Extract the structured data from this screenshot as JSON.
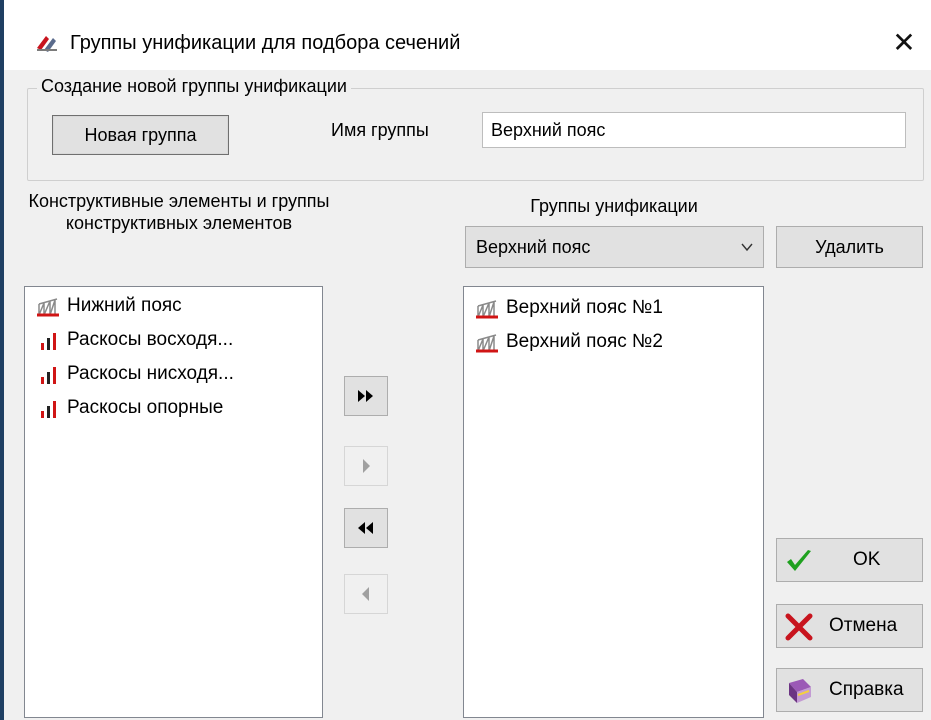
{
  "window": {
    "title": "Группы унификации для подбора сечений",
    "close_glyph": "✕"
  },
  "new_group": {
    "groupbox_title": "Создание новой группы унификации",
    "new_group_button": "Новая группа",
    "name_label": "Имя группы",
    "name_value": "Верхний пояс"
  },
  "left_panel": {
    "heading": "Конструктивные элементы и группы конструктивных элементов",
    "items": [
      {
        "label": "Нижний пояс",
        "icon": "truss-chord-icon"
      },
      {
        "label": "Раскосы восходя...",
        "icon": "bar-chart-icon"
      },
      {
        "label": "Раскосы нисходя...",
        "icon": "bar-chart-icon"
      },
      {
        "label": "Раскосы опорные",
        "icon": "bar-chart-icon"
      }
    ]
  },
  "right_panel": {
    "heading": "Группы унификации",
    "selected_group": "Верхний пояс",
    "delete_button": "Удалить",
    "items": [
      {
        "label": "Верхний пояс №1",
        "icon": "truss-chord-icon"
      },
      {
        "label": "Верхний пояс №2",
        "icon": "truss-chord-icon"
      }
    ]
  },
  "transfer_buttons": [
    {
      "name": "move-all-right-button",
      "icon": "double-right-arrow-icon",
      "enabled": true
    },
    {
      "name": "move-right-button",
      "icon": "right-arrow-icon",
      "enabled": false
    },
    {
      "name": "move-all-left-button",
      "icon": "double-left-arrow-icon",
      "enabled": true
    },
    {
      "name": "move-left-button",
      "icon": "left-arrow-icon",
      "enabled": false
    }
  ],
  "actions": {
    "ok": "OK",
    "cancel": "Отмена",
    "help": "Справка"
  },
  "colors": {
    "ok_check": "#1fa11f",
    "cancel_x": "#c8141e",
    "icon_red": "#d01515",
    "window_border": "#1f3f63"
  }
}
